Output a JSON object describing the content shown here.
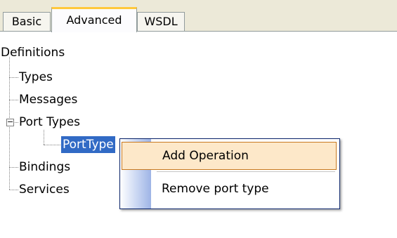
{
  "tabs": {
    "basic": "Basic",
    "advanced": "Advanced",
    "wsdl": "WSDL"
  },
  "tree": {
    "root": "Definitions",
    "types": "Types",
    "messages": "Messages",
    "port_types": "Port Types",
    "port_type_child": "PortType",
    "bindings": "Bindings",
    "services": "Services",
    "expander_symbol": "−"
  },
  "context_menu": {
    "add_operation": "Add Operation",
    "remove_port_type": "Remove port type"
  },
  "colors": {
    "selection": "#316ac5",
    "menu_highlight": "#fde8c9",
    "active_tab_accent": "#ffc83c"
  }
}
